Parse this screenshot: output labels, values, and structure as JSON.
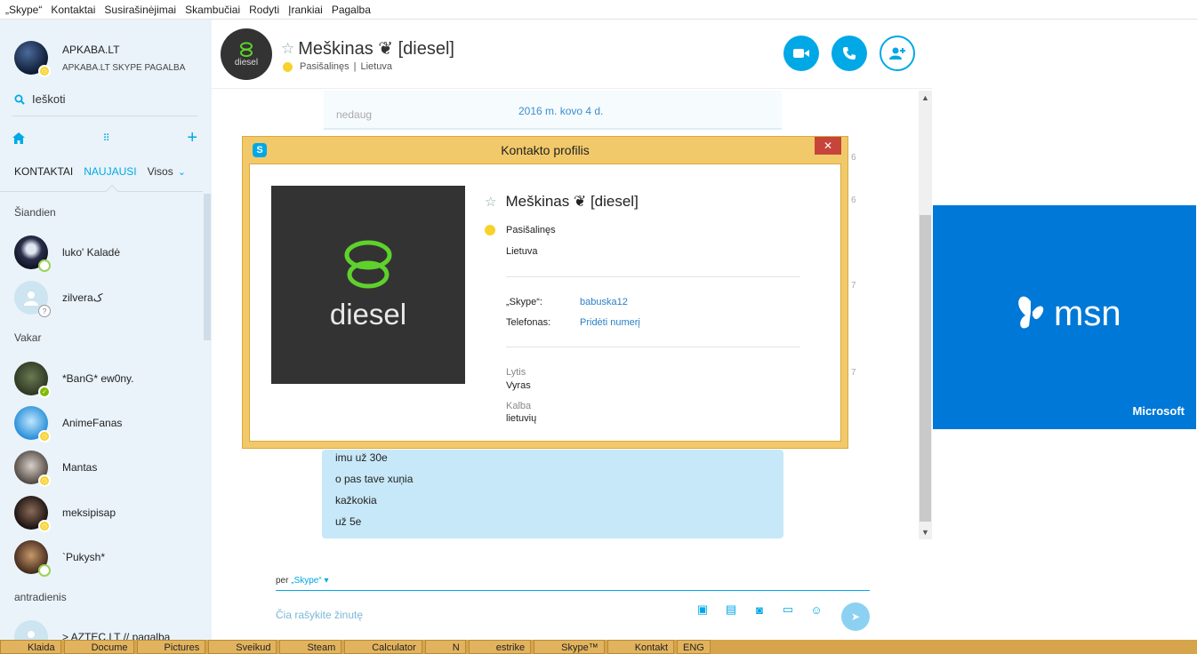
{
  "menu": [
    "„Skype“",
    "Kontaktai",
    "Susirašinėjimai",
    "Skambučiai",
    "Rodyti",
    "Įrankiai",
    "Pagalba"
  ],
  "sidebar": {
    "profile_name": "APKABA.LT",
    "profile_sub": "APKABA.LT SKYPE PAGALBA",
    "search_label": "Ieškoti",
    "tabs": [
      "KONTAKTAI",
      "NAUJAUSI",
      "Visos"
    ],
    "sections": {
      "today": "Šiandien",
      "yesterday": "Vakar",
      "tuesday": "antradienis"
    },
    "contacts": [
      {
        "name": "luko' Kaladė",
        "status": "offline"
      },
      {
        "name": "zilveraک",
        "status": "unknown"
      },
      {
        "name": "*BanG* ew0ny.",
        "status": "online"
      },
      {
        "name": "AnimeFanas",
        "status": "away"
      },
      {
        "name": "Mantas",
        "status": "away"
      },
      {
        "name": "meksipisap",
        "status": "away"
      },
      {
        "name": "`Pukysh*",
        "status": "offline"
      },
      {
        "name": "> AZTEC.LT // pagalba",
        "status": "none"
      }
    ]
  },
  "chat": {
    "title": "Meškinas ❦ [diesel]",
    "status": "Pasišalinęs",
    "location": "Lietuva",
    "avatar_text": "diesel",
    "date": "2016 m. kovo 4 d.",
    "old_message": "nedaug",
    "messages": [
      "imu už 30e",
      "o pas tave xuņia",
      "kažkokia",
      "už 5e"
    ],
    "side_numbers": [
      "6",
      "6",
      "7",
      "7"
    ],
    "via_prefix": "per",
    "via_link": "„Skype“",
    "compose_placeholder": "Čia rašykite žinutę"
  },
  "modal": {
    "title": "Kontakto profilis",
    "close": "✕",
    "name": "Meškinas ❦ [diesel]",
    "status": "Pasišalinęs",
    "country": "Lietuva",
    "skype_label": "„Skype“:",
    "skype_value": "babuska12",
    "phone_label": "Telefonas:",
    "phone_value": "Pridėti numerį",
    "gender_label": "Lytis",
    "gender_value": "Vyras",
    "language_label": "Kalba",
    "language_value": "lietuvių",
    "image_text": "diesel"
  },
  "ad": {
    "brand": "msn",
    "company": "Microsoft"
  },
  "taskbar": [
    "Klaida",
    "Docume",
    "Pictures",
    "Sveikud",
    "Steam",
    "Calculator",
    "N",
    "estrike",
    "Skype™",
    "Kontakt",
    "ENG"
  ],
  "colors": {
    "accent": "#00a8e6",
    "away": "#f8d22c",
    "online": "#7fba00",
    "msn": "#0078d7",
    "modal_frame": "#f2c96a"
  }
}
